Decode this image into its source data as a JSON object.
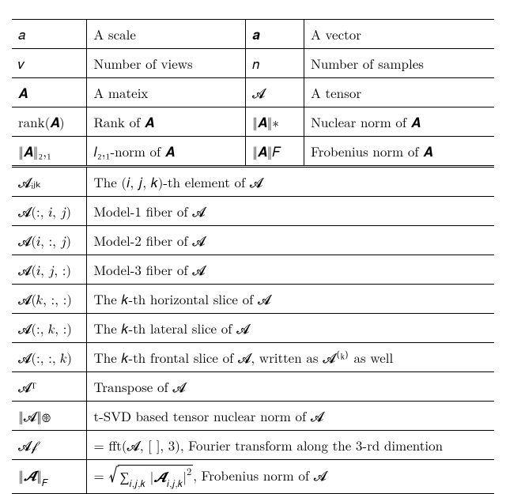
{
  "top_rows": [
    {
      "c0": "𝑎",
      "c1": "A scale",
      "c2": "𝒂",
      "c3": "A vector"
    },
    {
      "c0": "𝑣",
      "c1": "Number of views",
      "c2": "𝑛",
      "c3": "Number of samples"
    },
    {
      "c0": "𝑨",
      "c1": "A mateix",
      "c2": "𝓐",
      "c3": "A tensor"
    },
    {
      "c0": "rank(𝑨)",
      "c1": "Rank of 𝑨",
      "c2": "‖𝑨‖∗",
      "c3": "Nuclear norm of 𝑨"
    },
    {
      "c0": "‖𝑨‖₂,₁",
      "c1": "𝑙₂,₁-norm of 𝑨",
      "c2": "‖𝑨‖𝐹",
      "c3": "Frobenius norm of 𝑨"
    }
  ],
  "bottom_rows": [
    {
      "c0": "𝓐ᵢⱼₖ",
      "c1": "The (𝑖, 𝑗, 𝑘)-th element of 𝓐"
    },
    {
      "c0": "𝓐(:, 𝑖, 𝑗)",
      "c1": "Model-1 fiber of 𝓐"
    },
    {
      "c0": "𝓐(𝑖, :, 𝑗)",
      "c1": "Model-2 fiber of 𝓐"
    },
    {
      "c0": "𝓐(𝑖, 𝑗, :)",
      "c1": "Model-3 fiber of 𝓐"
    },
    {
      "c0": "𝓐(𝑘, :, :)",
      "c1": "The 𝑘-th horizontal slice of 𝓐"
    },
    {
      "c0": "𝓐(:, 𝑘, :)",
      "c1": "The 𝑘-th lateral slice of 𝓐"
    },
    {
      "c0": "𝓐(:, :, 𝑘)",
      "c1": "The 𝑘-th frontal slice of 𝓐, written as 𝓐⁽ᵏ⁾ as well"
    },
    {
      "c0": "𝓐ᵀ",
      "c1": "Transpose of 𝓐"
    },
    {
      "c0": "‖𝓐‖⊛",
      "c1": "t-SVD based tensor nuclear norm of 𝓐"
    },
    {
      "c0": "𝓐𝒻",
      "c1": "= fft(𝓐, [ ], 3), Fourier transform along the 3-rd dimention"
    }
  ],
  "r0_c0_norm_open": "‖",
  "r0_c0_A": "𝓐",
  "r0_c0_norm_close": "‖",
  "r0_c0_sub": "𝐹",
  "r0_c1_eq": "= ",
  "r0_c1_sum": "∑",
  "r0_c1_sum_sub": "𝑖,𝑗,𝑘",
  "r0_c1_bar1": " |",
  "r0_c1_Aijk": "𝓐",
  "r0_c1_Aijk_sub": "𝑖,𝑗,𝑘",
  "r0_c1_bar2": "|",
  "r0_c1_sq": "2",
  "r0_c1_tail": ", Frobenius norm of 𝓐"
}
